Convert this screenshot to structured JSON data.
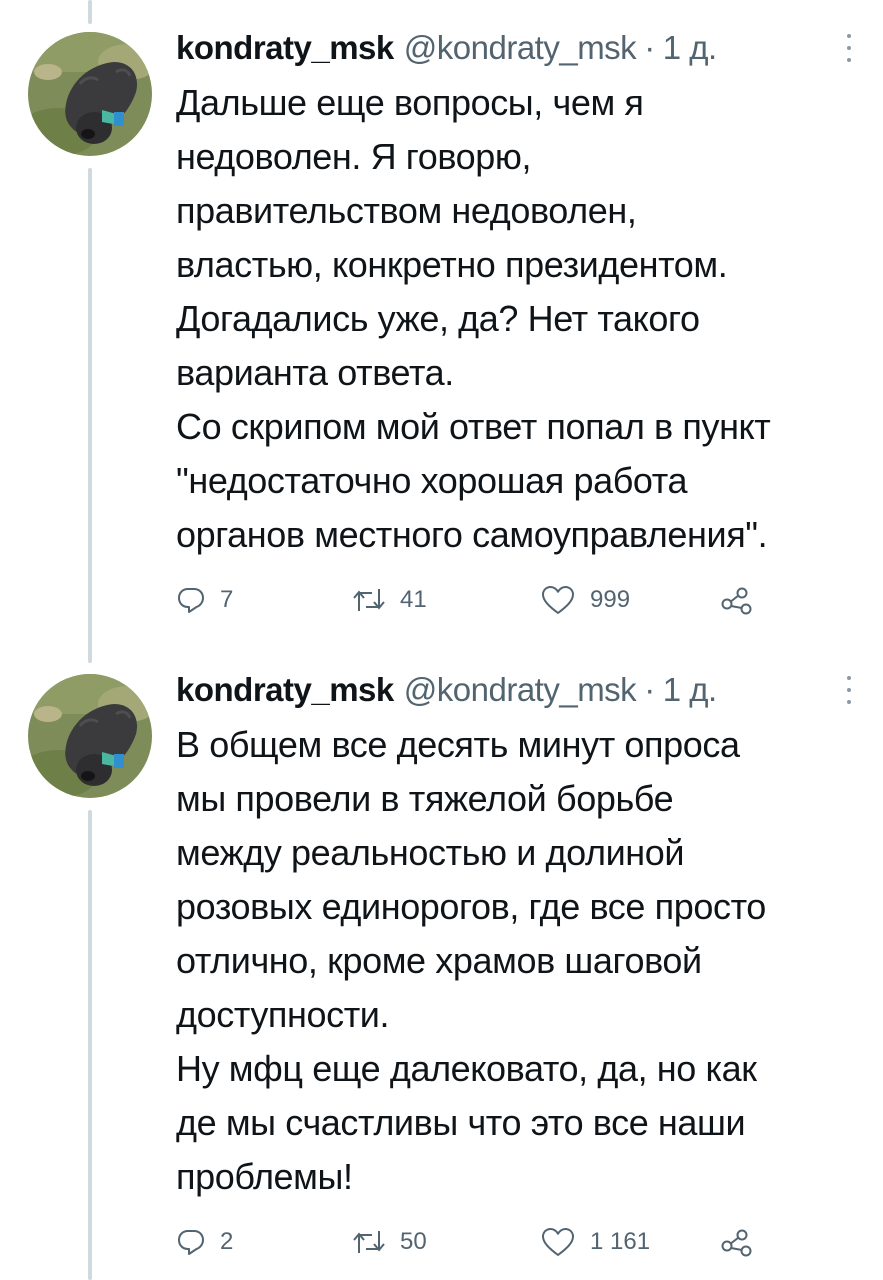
{
  "tweets": [
    {
      "author_name": "kondraty_msk",
      "handle": "@kondraty_msk",
      "separator": "·",
      "time": "1 д.",
      "lines": [
        "Дальше еще вопросы, чем я",
        "недоволен. Я говорю,",
        "правительством недоволен,",
        "властью, конкретно президентом.",
        "Догадались уже, да? Нет такого",
        "варианта ответа.",
        "Со скрипом мой ответ попал в пункт",
        "\"недостаточно хорошая работа",
        "органов местного самоуправления\"."
      ],
      "replies": "7",
      "retweets": "41",
      "likes": "999"
    },
    {
      "author_name": "kondraty_msk",
      "handle": "@kondraty_msk",
      "separator": "·",
      "time": "1 д.",
      "lines": [
        "В общем все десять минут опроса",
        "мы провели в тяжелой борьбе",
        "между реальностью и долиной",
        "розовых единорогов, где все просто",
        "отлично, кроме храмов шаговой",
        "доступности.",
        "Ну мфц еще далековато, да, но как",
        "де мы счастливы что это все наши",
        "проблемы!"
      ],
      "replies": "2",
      "retweets": "50",
      "likes": "1 161"
    }
  ],
  "icons": {
    "avatar": "dog-photo-avatar",
    "reply": "reply-icon",
    "retweet": "retweet-icon",
    "like": "heart-icon",
    "share": "share-icon",
    "more": "more-options-icon"
  },
  "colors": {
    "text": "#0f1419",
    "secondary": "#536471",
    "thread_line": "#cfd9de",
    "background": "#ffffff"
  }
}
